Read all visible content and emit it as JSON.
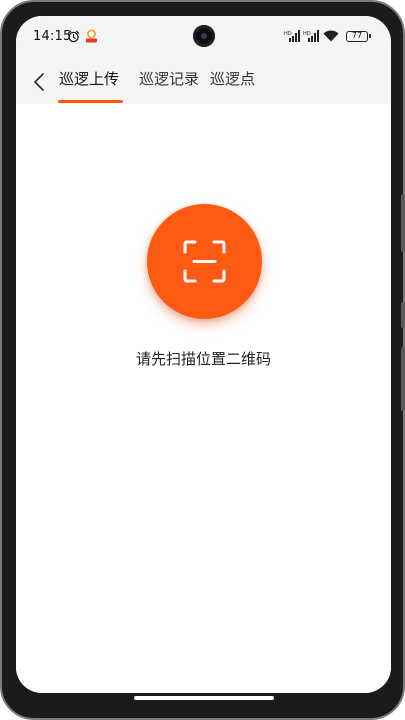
{
  "status_bar": {
    "time": "14:15",
    "battery": "77",
    "icons": [
      "alarm-icon",
      "app-notification-icon",
      "hd-signal-icon",
      "hd-signal-icon",
      "wifi-icon",
      "battery-icon"
    ]
  },
  "nav": {
    "back_icon": "chevron-left-icon",
    "tabs": [
      {
        "label": "巡逻上传",
        "active": true
      },
      {
        "label": "巡逻记录",
        "active": false
      },
      {
        "label": "巡逻点",
        "active": false
      }
    ]
  },
  "scan": {
    "icon": "scan-qr-icon",
    "hint": "请先扫描位置二维码"
  },
  "colors": {
    "accent": "#ff5a13",
    "header_bg": "#f5f5f5",
    "text": "#222222"
  }
}
